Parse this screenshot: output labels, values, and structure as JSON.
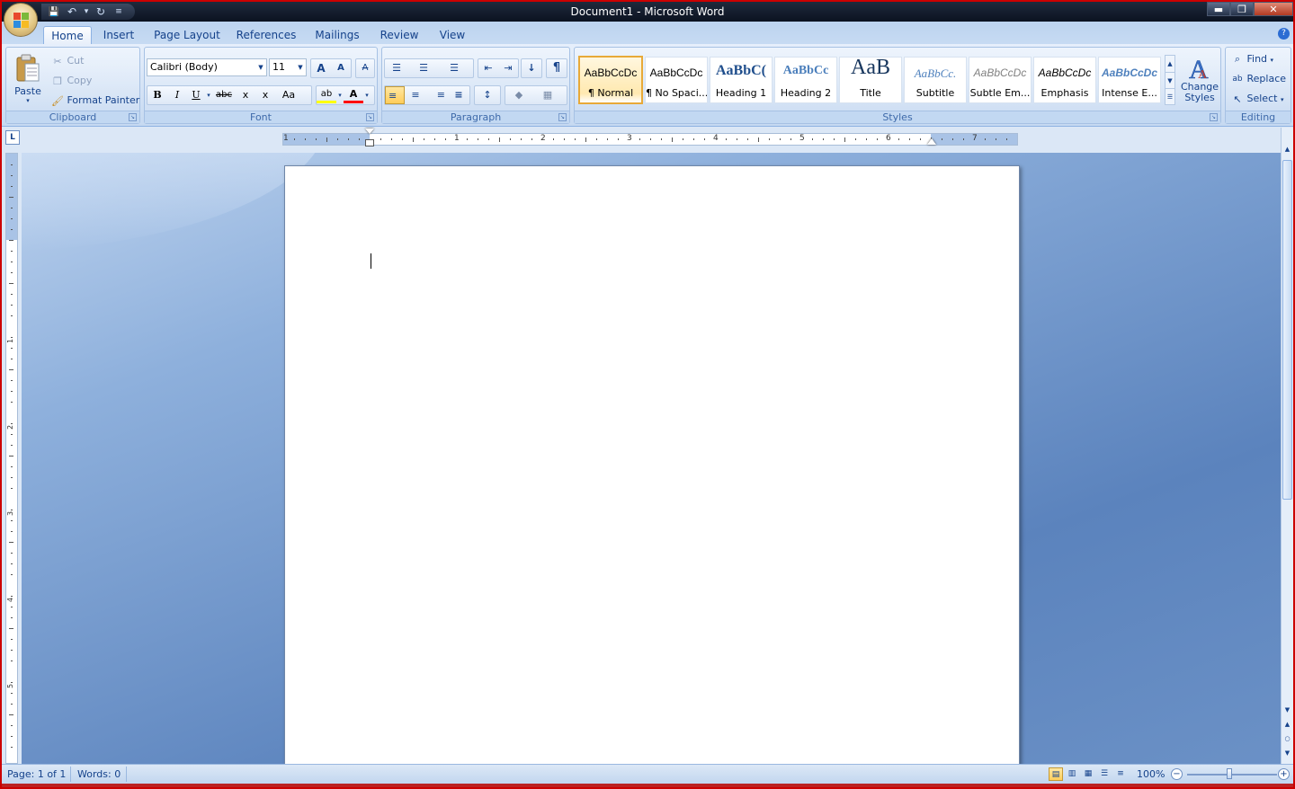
{
  "window": {
    "title": "Document1 - Microsoft Word",
    "controls": {
      "minimize": "▬",
      "restore": "❐",
      "close": "✕"
    }
  },
  "quick_access": {
    "save": "💾",
    "undo": "↶",
    "undo_dropdown": "▾",
    "redo": "↻",
    "customize": "≡"
  },
  "tabs": [
    {
      "label": "Home",
      "active": true
    },
    {
      "label": "Insert"
    },
    {
      "label": "Page Layout"
    },
    {
      "label": "References"
    },
    {
      "label": "Mailings"
    },
    {
      "label": "Review"
    },
    {
      "label": "View"
    }
  ],
  "help_label": "?",
  "clipboard": {
    "group_label": "Clipboard",
    "paste": "Paste",
    "cut": "Cut",
    "copy": "Copy",
    "format_painter": "Format Painter"
  },
  "font": {
    "group_label": "Font",
    "font_name": "Calibri (Body)",
    "font_size": "11",
    "grow": "A",
    "shrink": "A",
    "clear": "A",
    "bold": "B",
    "italic": "I",
    "underline": "U",
    "strikethrough": "abc",
    "subscript": "x",
    "superscript": "x",
    "change_case": "Aa",
    "highlight": "ab",
    "font_color": "A"
  },
  "paragraph": {
    "group_label": "Paragraph",
    "bullets": "☰",
    "numbering": "☰",
    "multilevel": "☰",
    "decrease_indent": "⇤",
    "increase_indent": "⇥",
    "sort": "↓",
    "show_marks": "¶",
    "align_left": "≡",
    "center": "≡",
    "align_right": "≡",
    "justify": "≡",
    "line_spacing": "↕",
    "shading": "◆",
    "borders": "▦"
  },
  "styles": {
    "group_label": "Styles",
    "items": [
      {
        "sample": "AaBbCcDc",
        "label": "¶ Normal",
        "selected": true
      },
      {
        "sample": "AaBbCcDc",
        "label": "¶ No Spaci..."
      },
      {
        "sample": "AaBbC(",
        "label": "Heading 1"
      },
      {
        "sample": "AaBbCc",
        "label": "Heading 2"
      },
      {
        "sample": "AaB",
        "label": "Title"
      },
      {
        "sample": "AaBbCc.",
        "label": "Subtitle"
      },
      {
        "sample": "AaBbCcDc",
        "label": "Subtle Em..."
      },
      {
        "sample": "AaBbCcDc",
        "label": "Emphasis"
      },
      {
        "sample": "AaBbCcDc",
        "label": "Intense E..."
      }
    ],
    "change_styles": "Change Styles"
  },
  "editing": {
    "group_label": "Editing",
    "find": "Find",
    "replace": "Replace",
    "select": "Select"
  },
  "ruler": {
    "tab_selector": "L",
    "numbers": [
      "1",
      "1",
      "2",
      "3",
      "4",
      "5",
      "6",
      "7"
    ],
    "vertical_numbers": [
      "1",
      "2",
      "3",
      "4",
      "5"
    ]
  },
  "status": {
    "page": "Page: 1 of 1",
    "words": "Words: 0",
    "zoom": "100%",
    "zoom_out": "−",
    "zoom_in": "+"
  },
  "colors": {
    "accent": "#15428b",
    "selected_style": "#e8a938",
    "highlight_yellow": "#ffff00",
    "font_red": "#ff0000"
  }
}
